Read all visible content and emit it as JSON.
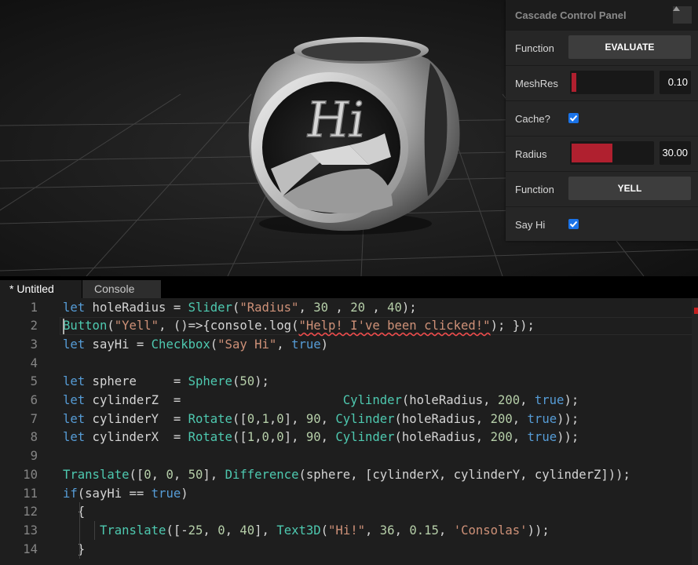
{
  "panel": {
    "title": "Cascade Control Panel",
    "collapse_icon": "triangle-up-icon",
    "controls": [
      {
        "label": "Function",
        "type": "button",
        "button_label": "EVALUATE"
      },
      {
        "label": "MeshRes",
        "type": "slider",
        "value": "0.10",
        "fill_fraction": 0.06
      },
      {
        "label": "Cache?",
        "type": "checkbox",
        "checked": true
      },
      {
        "label": "Radius",
        "type": "slider",
        "value": "30.00",
        "fill_fraction": 0.5
      },
      {
        "label": "Function",
        "type": "button",
        "button_label": "YELL"
      },
      {
        "label": "Say Hi",
        "type": "checkbox",
        "checked": true
      }
    ],
    "accent_color": "#b0202f",
    "checkbox_color": "#1a73e8"
  },
  "tabs": [
    {
      "label": "* Untitled",
      "active": true
    },
    {
      "label": "Console",
      "active": false
    }
  ],
  "editor": {
    "lines": [
      {
        "n": "1",
        "tokens": [
          [
            "kw",
            "let"
          ],
          [
            "id",
            " holeRadius = "
          ],
          [
            "fn",
            "Slider"
          ],
          [
            "id",
            "("
          ],
          [
            "str",
            "\"Radius\""
          ],
          [
            "id",
            ", "
          ],
          [
            "num",
            "30"
          ],
          [
            "id",
            " , "
          ],
          [
            "num",
            "20"
          ],
          [
            "id",
            " , "
          ],
          [
            "num",
            "40"
          ],
          [
            "id",
            ");"
          ]
        ]
      },
      {
        "n": "2",
        "tokens": [
          [
            "fn",
            "Button"
          ],
          [
            "id",
            "("
          ],
          [
            "str",
            "\"Yell\""
          ],
          [
            "id",
            ", ()=>{console.log("
          ],
          [
            "str",
            "\"Help! I've been clicked!\""
          ],
          [
            "id",
            "); });"
          ]
        ]
      },
      {
        "n": "3",
        "tokens": [
          [
            "kw",
            "let"
          ],
          [
            "id",
            " sayHi = "
          ],
          [
            "fn",
            "Checkbox"
          ],
          [
            "id",
            "("
          ],
          [
            "str",
            "\"Say Hi\""
          ],
          [
            "id",
            ", "
          ],
          [
            "kw",
            "true"
          ],
          [
            "id",
            ")"
          ]
        ]
      },
      {
        "n": "4",
        "tokens": []
      },
      {
        "n": "5",
        "tokens": [
          [
            "kw",
            "let"
          ],
          [
            "id",
            " sphere     = "
          ],
          [
            "fn",
            "Sphere"
          ],
          [
            "id",
            "("
          ],
          [
            "num",
            "50"
          ],
          [
            "id",
            ");"
          ]
        ]
      },
      {
        "n": "6",
        "tokens": [
          [
            "kw",
            "let"
          ],
          [
            "id",
            " cylinderZ  =                      "
          ],
          [
            "fn",
            "Cylinder"
          ],
          [
            "id",
            "(holeRadius, "
          ],
          [
            "num",
            "200"
          ],
          [
            "id",
            ", "
          ],
          [
            "kw",
            "true"
          ],
          [
            "id",
            ");"
          ]
        ]
      },
      {
        "n": "7",
        "tokens": [
          [
            "kw",
            "let"
          ],
          [
            "id",
            " cylinderY  = "
          ],
          [
            "fn",
            "Rotate"
          ],
          [
            "id",
            "(["
          ],
          [
            "num",
            "0"
          ],
          [
            "id",
            ","
          ],
          [
            "num",
            "1"
          ],
          [
            "id",
            ","
          ],
          [
            "num",
            "0"
          ],
          [
            "id",
            "], "
          ],
          [
            "num",
            "90"
          ],
          [
            "id",
            ", "
          ],
          [
            "fn",
            "Cylinder"
          ],
          [
            "id",
            "(holeRadius, "
          ],
          [
            "num",
            "200"
          ],
          [
            "id",
            ", "
          ],
          [
            "kw",
            "true"
          ],
          [
            "id",
            "));"
          ]
        ]
      },
      {
        "n": "8",
        "tokens": [
          [
            "kw",
            "let"
          ],
          [
            "id",
            " cylinderX  = "
          ],
          [
            "fn",
            "Rotate"
          ],
          [
            "id",
            "(["
          ],
          [
            "num",
            "1"
          ],
          [
            "id",
            ","
          ],
          [
            "num",
            "0"
          ],
          [
            "id",
            ","
          ],
          [
            "num",
            "0"
          ],
          [
            "id",
            "], "
          ],
          [
            "num",
            "90"
          ],
          [
            "id",
            ", "
          ],
          [
            "fn",
            "Cylinder"
          ],
          [
            "id",
            "(holeRadius, "
          ],
          [
            "num",
            "200"
          ],
          [
            "id",
            ", "
          ],
          [
            "kw",
            "true"
          ],
          [
            "id",
            "));"
          ]
        ]
      },
      {
        "n": "9",
        "tokens": []
      },
      {
        "n": "10",
        "tokens": [
          [
            "fn",
            "Translate"
          ],
          [
            "id",
            "(["
          ],
          [
            "num",
            "0"
          ],
          [
            "id",
            ", "
          ],
          [
            "num",
            "0"
          ],
          [
            "id",
            ", "
          ],
          [
            "num",
            "50"
          ],
          [
            "id",
            "], "
          ],
          [
            "fn",
            "Difference"
          ],
          [
            "id",
            "(sphere, [cylinderX, cylinderY, cylinderZ]));"
          ]
        ]
      },
      {
        "n": "11",
        "tokens": [
          [
            "kw",
            "if"
          ],
          [
            "id",
            "(sayHi == "
          ],
          [
            "kw",
            "true"
          ],
          [
            "id",
            ")"
          ]
        ]
      },
      {
        "n": "12",
        "tokens": [
          [
            "id",
            "  {"
          ]
        ]
      },
      {
        "n": "13",
        "tokens": [
          [
            "id",
            "     "
          ],
          [
            "fn",
            "Translate"
          ],
          [
            "id",
            "([-"
          ],
          [
            "num",
            "25"
          ],
          [
            "id",
            ", "
          ],
          [
            "num",
            "0"
          ],
          [
            "id",
            ", "
          ],
          [
            "num",
            "40"
          ],
          [
            "id",
            "], "
          ],
          [
            "fn",
            "Text3D"
          ],
          [
            "id",
            "("
          ],
          [
            "str",
            "\"Hi!\""
          ],
          [
            "id",
            ", "
          ],
          [
            "num",
            "36"
          ],
          [
            "id",
            ", "
          ],
          [
            "num",
            "0.15"
          ],
          [
            "id",
            ", "
          ],
          [
            "str",
            "'Consolas'"
          ],
          [
            "id",
            "));"
          ]
        ]
      },
      {
        "n": "14",
        "tokens": [
          [
            "id",
            "  }"
          ]
        ]
      }
    ]
  },
  "model_text": "Hi"
}
